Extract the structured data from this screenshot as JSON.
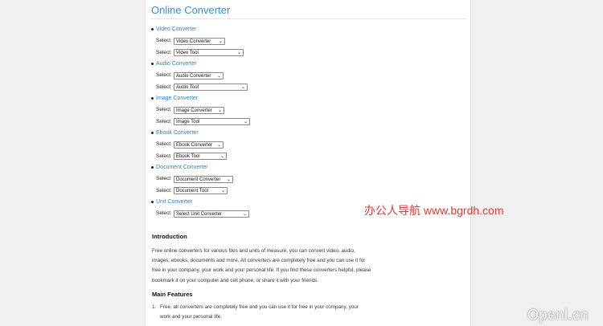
{
  "site_title": "Online Converter",
  "select_label": "Select",
  "groups": [
    {
      "name": "Video Converter",
      "selects": [
        "Video Converter",
        "Video Tool"
      ]
    },
    {
      "name": "Audio Converter",
      "selects": [
        "Audio Converter",
        "Audio Tool"
      ]
    },
    {
      "name": "Image Converter",
      "selects": [
        "Image Converter",
        "Image Tool"
      ]
    },
    {
      "name": "Ebook Converter",
      "selects": [
        "Ebook Converter",
        "Ebook Tool"
      ]
    },
    {
      "name": "Document Converter",
      "selects": [
        "Document Converter",
        "Document Tool"
      ]
    },
    {
      "name": "Unit Converter",
      "selects": [
        "Select Unit Converter"
      ]
    }
  ],
  "intro": {
    "heading": "Introduction",
    "lines": [
      "Free online converters for various files and units of measure, you can convert video, audio,",
      "images, ebooks, documents and more. All converters are completely free and you can use it for",
      "free in your company, your work and your personal life. If you find these converters helpful, please",
      "bookmark it on your computer and cell phone, or share it with your friends."
    ]
  },
  "features": {
    "heading": "Main Features",
    "item1_num": "1.",
    "item1_line1": "Free, all converters are completely free and you can use it for free in your company, your",
    "item1_line2": "work and your personal life."
  },
  "watermarks": {
    "cn": "办公人导航 www.bgrdh.com",
    "corner": "Openl.cn"
  }
}
